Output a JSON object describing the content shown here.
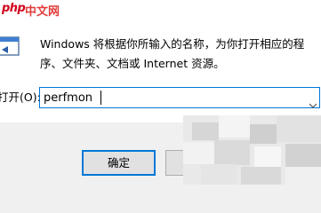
{
  "watermark": {
    "logo": "php",
    "text": "中文网"
  },
  "run_dialog": {
    "description": "Windows 将根据你所输入的名称，为你打开相应的程序、文件夹、文档或 Internet 资源。",
    "open_label": "打开(O):",
    "open_value": "perfmon",
    "ok_label": "确定",
    "colors": {
      "accent": "#0078d7",
      "watermark": "#d0021b"
    },
    "icons": [
      "run-icon",
      "dropdown-arrow-icon"
    ]
  }
}
